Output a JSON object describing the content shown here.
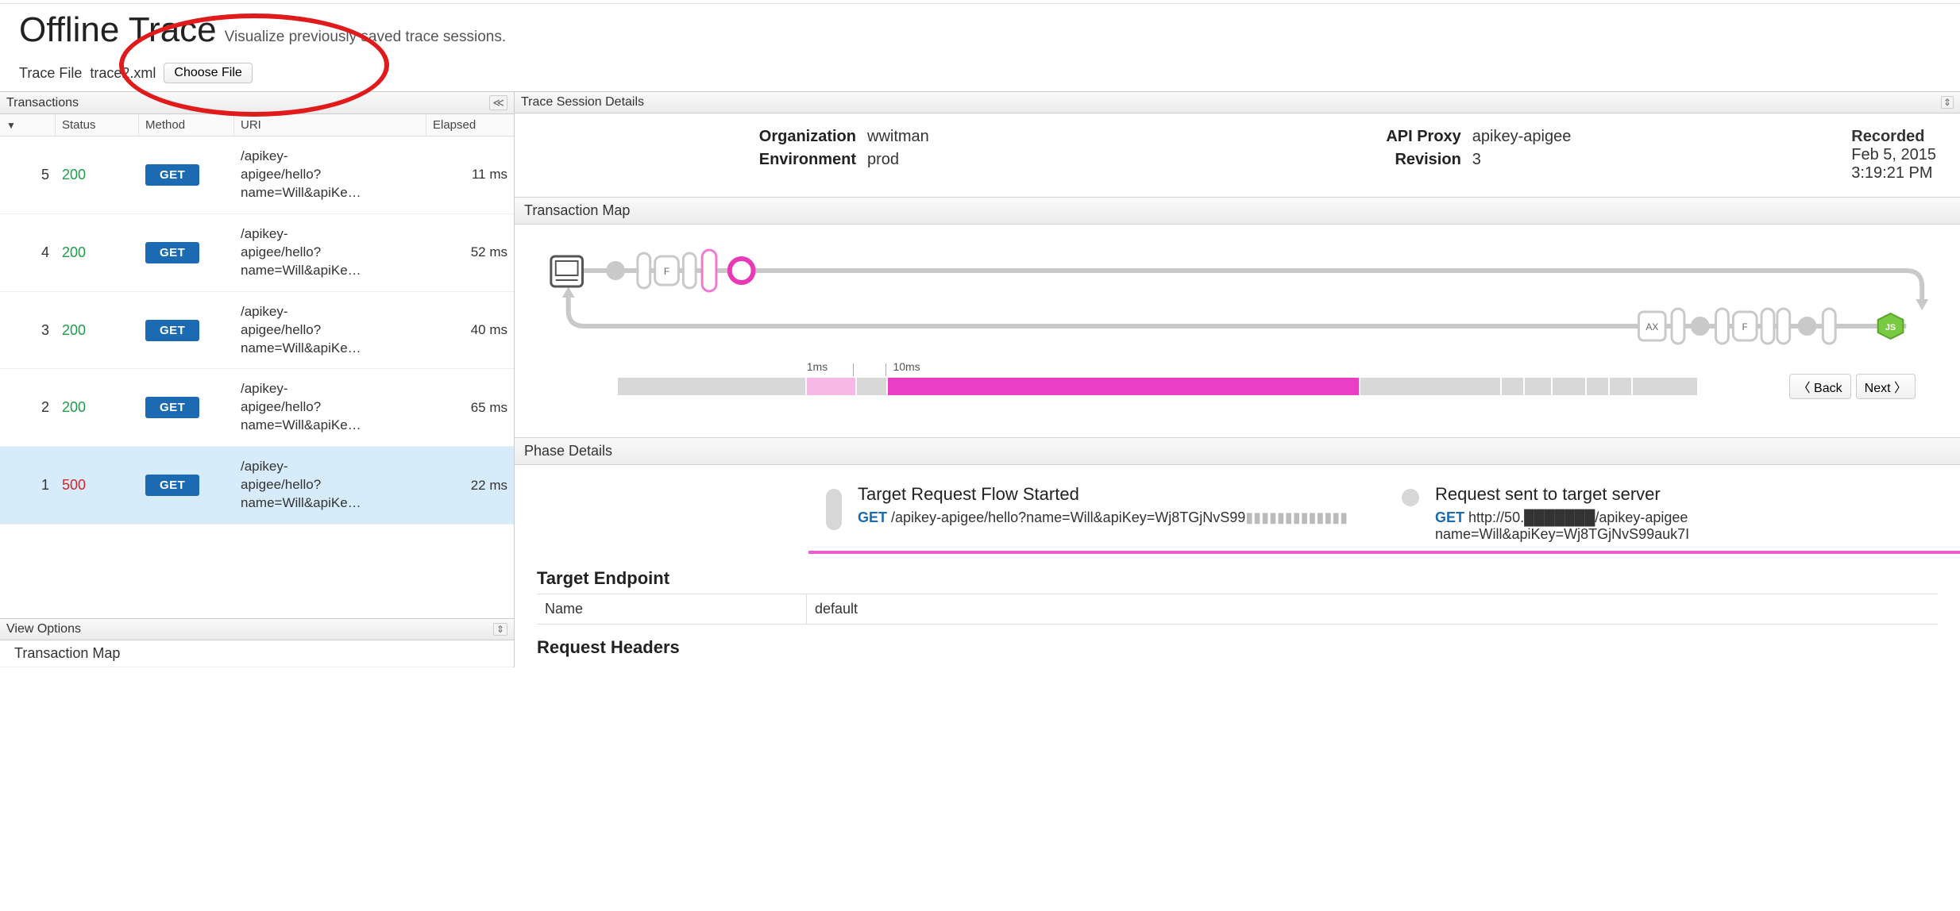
{
  "page": {
    "title": "Offline Trace",
    "subtitle": "Visualize previously saved trace sessions."
  },
  "traceFile": {
    "label": "Trace File",
    "filename": "trace2.xml",
    "chooseLabel": "Choose File"
  },
  "transactionsPanel": {
    "title": "Transactions",
    "collapseGlyph": "≪",
    "columns": {
      "sortArrow": "▼",
      "status": "Status",
      "method": "Method",
      "uri": "URI",
      "elapsed": "Elapsed"
    }
  },
  "transactions": [
    {
      "idx": "5",
      "status": "200",
      "statusClass": "status-200",
      "method": "GET",
      "uri": "/apikey-apigee/hello?name=Will&apiKe…",
      "elapsed": "11 ms",
      "selected": false
    },
    {
      "idx": "4",
      "status": "200",
      "statusClass": "status-200",
      "method": "GET",
      "uri": "/apikey-apigee/hello?name=Will&apiKe…",
      "elapsed": "52 ms",
      "selected": false
    },
    {
      "idx": "3",
      "status": "200",
      "statusClass": "status-200",
      "method": "GET",
      "uri": "/apikey-apigee/hello?name=Will&apiKe…",
      "elapsed": "40 ms",
      "selected": false
    },
    {
      "idx": "2",
      "status": "200",
      "statusClass": "status-200",
      "method": "GET",
      "uri": "/apikey-apigee/hello?name=Will&apiKe…",
      "elapsed": "65 ms",
      "selected": false
    },
    {
      "idx": "1",
      "status": "500",
      "statusClass": "status-500",
      "method": "GET",
      "uri": "/apikey-apigee/hello?name=Will&apiKe…",
      "elapsed": "22 ms",
      "selected": true
    }
  ],
  "viewOptions": {
    "title": "View Options",
    "toggleGlyph": "⇕",
    "items": [
      "Transaction Map"
    ]
  },
  "detailsPanel": {
    "title": "Trace Session Details",
    "collapseGlyph": "⇕"
  },
  "info": {
    "org": {
      "label": "Organization",
      "value": "wwitman"
    },
    "env": {
      "label": "Environment",
      "value": "prod"
    },
    "proxy": {
      "label": "API Proxy",
      "value": "apikey-apigee"
    },
    "rev": {
      "label": "Revision",
      "value": "3"
    },
    "recorded": {
      "label": "Recorded",
      "date": "Feb 5, 2015",
      "time": "3:19:21 PM"
    }
  },
  "sections": {
    "txmap": "Transaction Map",
    "phase": "Phase Details"
  },
  "txmap": {
    "badges": {
      "f": "F",
      "ax": "AX",
      "js": "JS"
    },
    "timeline": {
      "t1": "1ms",
      "t2": "10ms"
    },
    "buttons": {
      "back": "〈 Back",
      "next": "Next 〉"
    }
  },
  "phase": {
    "left": {
      "title": "Target Request Flow Started",
      "method": "GET",
      "path": "/apikey-apigee/hello?name=Will&apiKey=Wj8TGjNvS99"
    },
    "right": {
      "title": "Request sent to target server",
      "method": "GET",
      "path": "http://50.███████/apikey-apigee",
      "line2": "name=Will&apiKey=Wj8TGjNvS99auk7I"
    }
  },
  "targetEndpoint": {
    "heading": "Target Endpoint",
    "rows": [
      {
        "k": "Name",
        "v": "default"
      }
    ]
  },
  "requestHeaders": {
    "heading": "Request Headers"
  }
}
